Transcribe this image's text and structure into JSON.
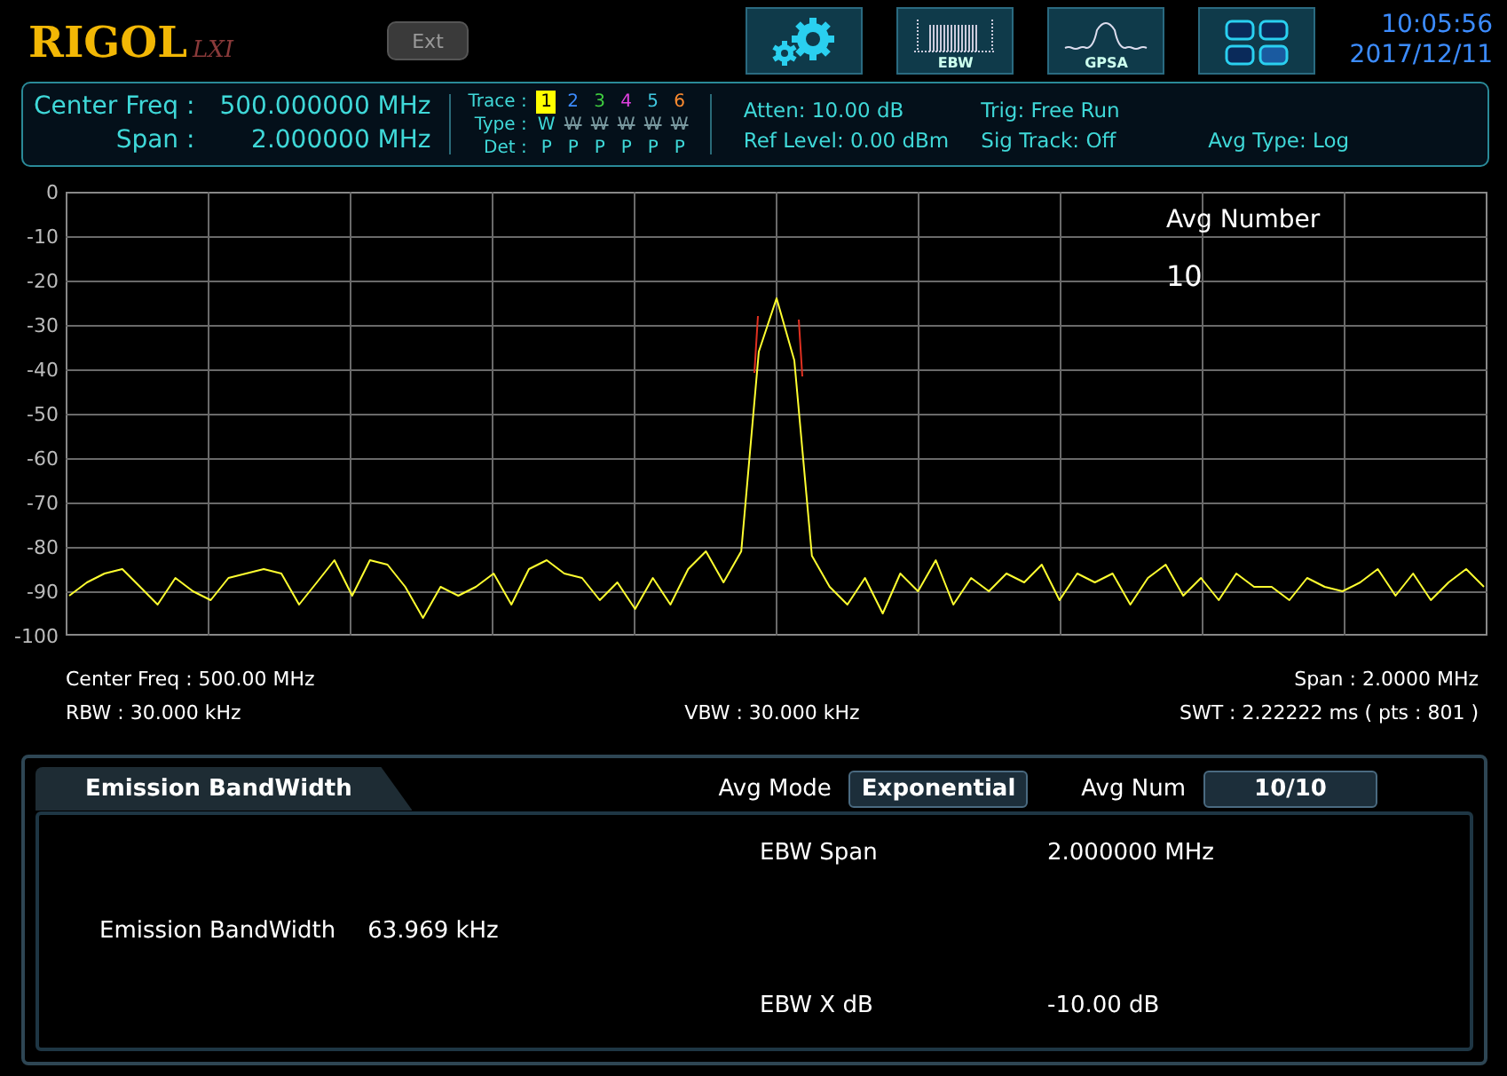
{
  "logo": {
    "brand": "RIGOL",
    "badge": "LXI"
  },
  "ext_button": "Ext",
  "toolbar": [
    {
      "kind": "settings"
    },
    {
      "kind": "ebw",
      "label": "EBW"
    },
    {
      "kind": "gpsa",
      "label": "GPSA"
    },
    {
      "kind": "layout"
    }
  ],
  "clock": {
    "time": "10:05:56",
    "date": "2017/12/11"
  },
  "info": {
    "fields": [
      {
        "label": "Center Freq :",
        "value": "500.000000 MHz"
      },
      {
        "label": "Span :",
        "value": "2.000000 MHz"
      }
    ],
    "trace_labels": {
      "trace": "Trace :",
      "type": "Type :",
      "det": "Det :"
    },
    "traces": [
      {
        "number": "1",
        "color": "#ffff00",
        "selected": true,
        "type": "W",
        "type_on": true,
        "det": "P"
      },
      {
        "number": "2",
        "color": "#3c8cff",
        "selected": false,
        "type": "W",
        "type_on": false,
        "det": "P"
      },
      {
        "number": "3",
        "color": "#40d040",
        "selected": false,
        "type": "W",
        "type_on": false,
        "det": "P"
      },
      {
        "number": "4",
        "color": "#e040e0",
        "selected": false,
        "type": "W",
        "type_on": false,
        "det": "P"
      },
      {
        "number": "5",
        "color": "#40c8e0",
        "selected": false,
        "type": "W",
        "type_on": false,
        "det": "P"
      },
      {
        "number": "6",
        "color": "#ff8c30",
        "selected": false,
        "type": "W",
        "type_on": false,
        "det": "P"
      }
    ],
    "status_columns": [
      [
        "Atten: 10.00 dB",
        "Ref Level: 0.00 dBm"
      ],
      [
        "Trig: Free Run",
        "Sig Track: Off"
      ],
      [
        "Avg Type: Log"
      ]
    ]
  },
  "plot": {
    "chart_data": {
      "type": "line",
      "grid": true,
      "ylim": [
        -100,
        0
      ],
      "yticks": [
        0,
        -10,
        -20,
        -30,
        -40,
        -50,
        -60,
        -70,
        -80,
        -90,
        -100
      ],
      "categories": [
        null,
        null,
        null,
        null,
        null,
        null,
        null,
        null,
        null,
        null,
        null,
        null,
        null,
        null,
        null,
        null,
        null,
        null,
        null,
        null,
        null,
        null,
        null,
        null,
        null,
        null,
        null,
        null,
        null,
        null,
        null,
        null,
        null,
        null,
        null,
        null,
        null,
        null,
        null,
        null,
        null,
        null,
        null,
        null,
        null,
        null,
        null,
        null,
        null,
        null,
        null,
        null,
        null,
        null,
        null,
        null,
        null,
        null,
        null,
        null,
        null,
        null,
        null,
        null,
        null,
        null,
        null,
        null,
        null,
        null,
        null,
        null,
        null,
        null,
        null,
        null,
        null,
        null,
        null,
        null,
        null
      ],
      "series": [
        {
          "color": "#ffff30",
          "values": [
            -91,
            -88,
            -86,
            -85,
            -89,
            -93,
            -87,
            -90,
            -92,
            -87,
            -86,
            -85,
            -86,
            -93,
            -88,
            -83,
            -91,
            -83,
            -84,
            -89,
            -96,
            -89,
            -91,
            -89,
            -86,
            -93,
            -85,
            -83,
            -86,
            -87,
            -92,
            -88,
            -94,
            -87,
            -93,
            -85,
            -81,
            -88,
            -81,
            -36,
            -24,
            -38,
            -82,
            -89,
            -93,
            -87,
            -95,
            -86,
            -90,
            -83,
            -93,
            -87,
            -90,
            -86,
            -88,
            -84,
            -92,
            -86,
            -88,
            -86,
            -93,
            -87,
            -84,
            -91,
            -87,
            -92,
            -86,
            -89,
            -89,
            -92,
            -87,
            -89,
            -90,
            -88,
            -85,
            -91,
            -86,
            -92,
            -88,
            -85,
            -89
          ]
        }
      ]
    },
    "overlay": {
      "title": "Avg Number",
      "value": "10"
    }
  },
  "plot_footer": {
    "left": [
      "Center Freq : 500.00 MHz",
      "RBW : 30.000 kHz"
    ],
    "center": "VBW : 30.000 kHz",
    "right": [
      "Span : 2.0000 MHz",
      "SWT : 2.22222 ms ( pts : 801 )"
    ]
  },
  "panel": {
    "tab": "Emission BandWidth",
    "avg_mode": {
      "label": "Avg Mode",
      "value": "Exponential"
    },
    "avg_num": {
      "label": "Avg Num",
      "value": "10/10"
    },
    "result": {
      "label": "Emission BandWidth",
      "value": "63.969 kHz"
    },
    "params": [
      {
        "label": "EBW Span",
        "value": "2.000000 MHz"
      },
      {
        "label": "EBW X dB",
        "value": "-10.00 dB"
      }
    ]
  }
}
